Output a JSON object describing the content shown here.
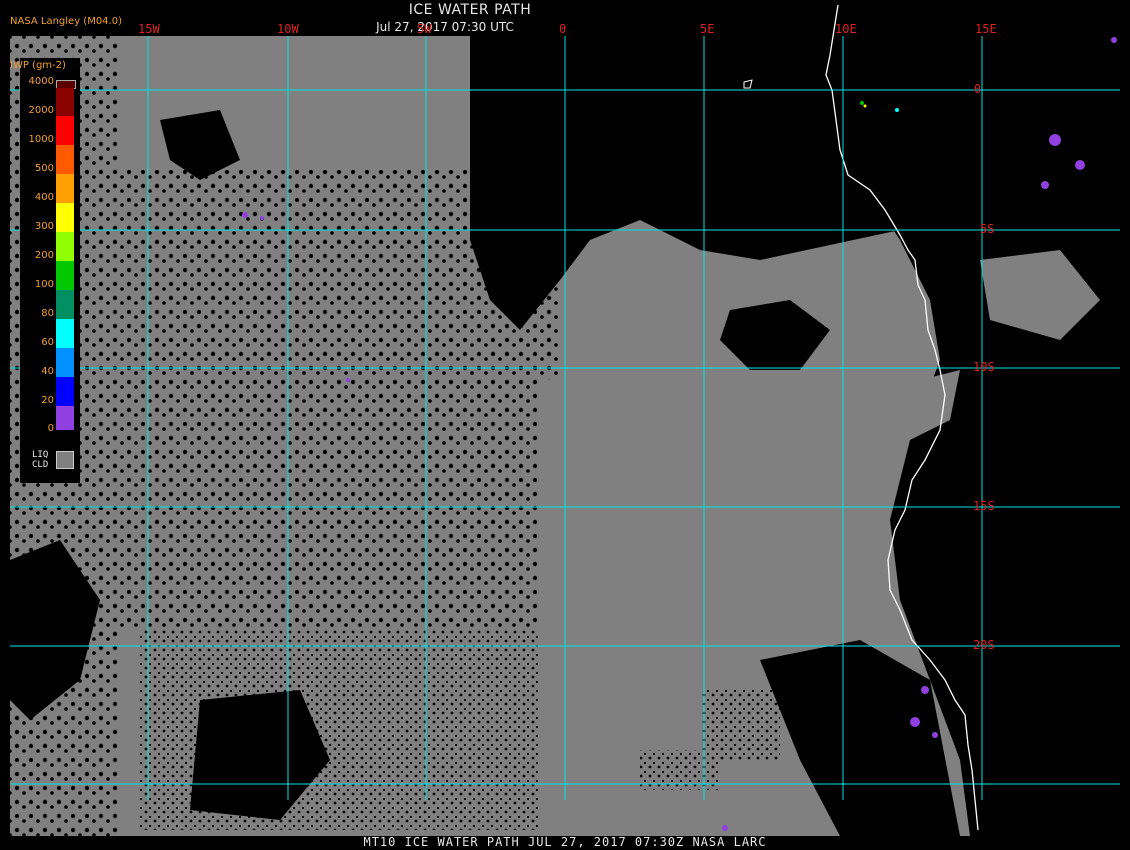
{
  "header": {
    "title": "ICE WATER PATH",
    "subtitle": "Jul 27, 2017 07:30 UTC",
    "producer": "NASA Langley (M04.0)"
  },
  "footer": {
    "caption": "MT10  ICE WATER PATH   JUL 27, 2017 07:30Z   NASA LARC"
  },
  "map": {
    "longitude_labels": [
      "15W",
      "10W",
      "5W",
      "0",
      "5E",
      "10E",
      "15E"
    ],
    "latitude_labels": [
      "0",
      "5S",
      "10S",
      "15S",
      "20S"
    ],
    "colors": {
      "background": "#000000",
      "liquid_cloud": "#808080",
      "grid": "#00e5e5",
      "coastline": "#ffffff",
      "labels": "#dd2222"
    }
  },
  "legend": {
    "unit": "IWP (gm-2)",
    "values": [
      "4000",
      "2000",
      "1000",
      "500",
      "400",
      "300",
      "200",
      "100",
      "80",
      "60",
      "40",
      "20",
      "0"
    ],
    "colors": [
      "#5a0000",
      "#8b0000",
      "#ff0000",
      "#ff5a00",
      "#ffa000",
      "#ffff00",
      "#90ff00",
      "#00c800",
      "#008f60",
      "#00ffff",
      "#0090ff",
      "#0000ff",
      "#9040e0"
    ],
    "liquid_label_1": "LIQ",
    "liquid_label_2": "CLD"
  }
}
